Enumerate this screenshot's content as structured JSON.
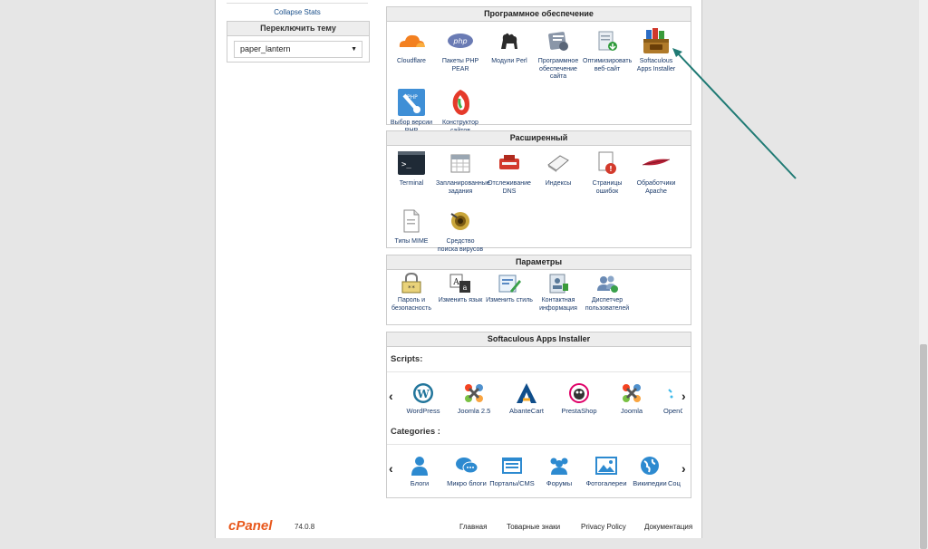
{
  "sidebar": {
    "collapse_stats": "Collapse Stats",
    "theme_title": "Переключить тему",
    "theme_value": "paper_lantern"
  },
  "software": {
    "title": "Программное обеспечение",
    "items": [
      {
        "label": "Cloudflare",
        "icon": "cloudflare-icon"
      },
      {
        "label": "Пакеты PHP PEAR",
        "icon": "php-icon"
      },
      {
        "label": "Модули Perl",
        "icon": "perl-camel-icon"
      },
      {
        "label": "Программное обеспечение сайта",
        "icon": "site-software-icon"
      },
      {
        "label": "Оптимизировать веб-сайт",
        "icon": "optimize-icon"
      },
      {
        "label": "Softaculous Apps Installer",
        "icon": "softaculous-icon"
      },
      {
        "label": "Выбор версии PHP",
        "icon": "php-version-icon"
      },
      {
        "label": "Конструктор сайтов",
        "icon": "site-builder-icon"
      }
    ]
  },
  "advanced": {
    "title": "Расширенный",
    "items": [
      {
        "label": "Terminal",
        "icon": "terminal-icon"
      },
      {
        "label": "Запланированные задания",
        "icon": "calendar-icon"
      },
      {
        "label": "Отслеживание DNS",
        "icon": "dns-icon"
      },
      {
        "label": "Индексы",
        "icon": "index-icon"
      },
      {
        "label": "Страницы ошибок",
        "icon": "error-page-icon"
      },
      {
        "label": "Обработчики Apache",
        "icon": "apache-feather-icon"
      },
      {
        "label": "Типы MIME",
        "icon": "mime-icon"
      },
      {
        "label": "Средство поиска вирусов",
        "icon": "virus-scanner-icon"
      }
    ]
  },
  "preferences": {
    "title": "Параметры",
    "items": [
      {
        "label": "Пароль и безопасность",
        "icon": "password-lock-icon"
      },
      {
        "label": "Изменить язык",
        "icon": "language-icon"
      },
      {
        "label": "Изменить стиль",
        "icon": "style-icon"
      },
      {
        "label": "Контактная информация",
        "icon": "contact-icon"
      },
      {
        "label": "Диспетчер пользователей",
        "icon": "user-manager-icon"
      }
    ]
  },
  "softaculous": {
    "title": "Softaculous Apps Installer",
    "scripts_label": "Scripts:",
    "scripts": [
      "WordPress",
      "Joomla 2.5",
      "AbanteCart",
      "PrestaShop",
      "Joomla",
      "OpenCart"
    ],
    "categories_label": "Categories :",
    "categories": [
      "Блоги",
      "Микро блоги",
      "Порталы/CMS",
      "Форумы",
      "Фотогалереи",
      "Википедии",
      "Социальные"
    ]
  },
  "footer": {
    "logo": "cPanel",
    "version": "74.0.8",
    "links": [
      "Главная",
      "Товарные знаки",
      "Privacy Policy",
      "Документация"
    ]
  },
  "colors": {
    "accent": "#e8581c",
    "link": "#1a3a6a",
    "annotation_arrow": "#1f7a74"
  }
}
